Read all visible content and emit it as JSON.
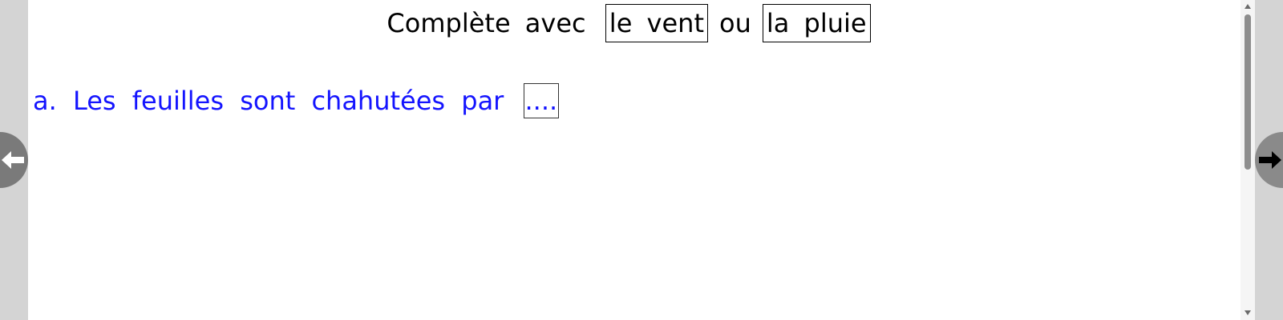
{
  "instruction": {
    "prefix": "Complète avec",
    "choices": [
      "le vent",
      "la pluie"
    ],
    "connector": "ou"
  },
  "exercise": {
    "items": [
      {
        "label": "a.",
        "text": "Les feuilles sont chahutées par",
        "blank": "...."
      }
    ]
  },
  "navigation": {
    "prev_icon": "arrow-left-icon",
    "next_icon": "arrow-right-icon"
  },
  "colors": {
    "exercise_text": "#1414ff",
    "instruction_text": "#000000",
    "side_panel": "#d4d4d4",
    "nav_button": "#7a7a7a"
  }
}
